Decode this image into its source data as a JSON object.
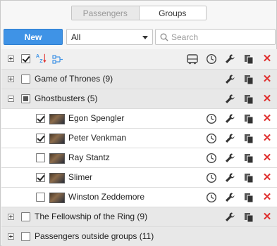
{
  "tabs": [
    {
      "label": "Passengers",
      "active": false
    },
    {
      "label": "Groups",
      "active": true
    }
  ],
  "toolbar": {
    "new_label": "New",
    "filter_value": "All",
    "search_placeholder": "Search"
  },
  "colors": {
    "accent": "#3f93e6",
    "delete": "#e0302f",
    "group_row": "#e8e8e8"
  },
  "header_icons": [
    "sort-az-icon",
    "tree-icon",
    "bus-icon",
    "clock-icon",
    "wrench-icon",
    "copy-icon",
    "close-icon"
  ],
  "groups": [
    {
      "name": "Game of Thrones (9)",
      "expanded": false,
      "checked": false
    },
    {
      "name": "Ghostbusters (5)",
      "expanded": true,
      "checked": "partial",
      "members": [
        {
          "name": "Egon Spengler",
          "checked": true
        },
        {
          "name": "Peter Venkman",
          "checked": true
        },
        {
          "name": "Ray Stantz",
          "checked": false
        },
        {
          "name": "Slimer",
          "checked": true
        },
        {
          "name": "Winston Zeddemore",
          "checked": false
        }
      ]
    },
    {
      "name": "The Fellowship of the Ring (9)",
      "expanded": false,
      "checked": false
    },
    {
      "name": "Passengers outside groups (11)",
      "expanded": false,
      "checked": false
    }
  ]
}
